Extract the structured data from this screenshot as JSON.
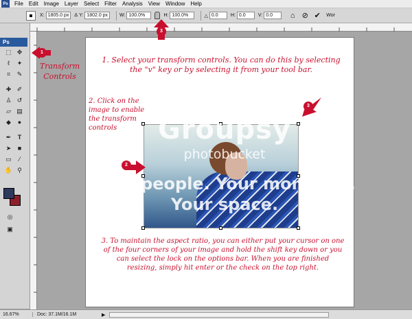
{
  "app": {
    "logo_small": "Ps",
    "logo_panel": "Ps"
  },
  "menu": [
    "File",
    "Edit",
    "Image",
    "Layer",
    "Select",
    "Filter",
    "Analysis",
    "View",
    "Window",
    "Help"
  ],
  "options": {
    "x_label": "X:",
    "x_value": "1805.0 px",
    "y_label": "Y:",
    "y_value": "1802.0 px",
    "w_label": "W:",
    "w_value": "100.0%",
    "h_label": "H:",
    "h_value": "100.0%",
    "rot_value": "0.0",
    "hskew_label": "H:",
    "hskew_value": "0.0",
    "vskew_label": "V:",
    "vskew_value": "0.0",
    "workspace_label": "Wor"
  },
  "status": {
    "zoom": "16.67%",
    "doc": "Doc: 37.1M/16.1M"
  },
  "annotations": {
    "transform_controls": "Transform Controls",
    "step1": "1. Select your transform controls. You can do this by selecting the \"v\" key or by selecting it from your tool bar.",
    "step2": "2. Click on the image to enable the transform controls",
    "step3": "3. To maintain the aspect ratio, you can either put your cursor on one of the four corners of your image and hold the shift key down or you can select the lock on the options bar. When you are finished resizing, simply hit enter or the check on the top right.",
    "badge1": "1",
    "badge2": "2",
    "badge3a": "3",
    "badge3b": "3"
  },
  "watermark": {
    "brand": "Groupsy",
    "sub": "photobucket",
    "line1": "Your people. Your moments.",
    "line2": "Your space."
  },
  "colors": {
    "annotation_red": "#c8102e",
    "foreground_swatch": "#2e3a5c",
    "background_swatch": "#8d1f2b"
  },
  "icons": [
    "move-tool-icon",
    "marquee-tool-icon",
    "lasso-tool-icon",
    "magic-wand-icon",
    "crop-tool-icon",
    "slice-tool-icon",
    "healing-brush-icon",
    "brush-tool-icon",
    "clone-stamp-icon",
    "history-brush-icon",
    "eraser-tool-icon",
    "gradient-tool-icon",
    "blur-tool-icon",
    "dodge-tool-icon",
    "pen-tool-icon",
    "type-tool-icon",
    "path-select-icon",
    "shape-tool-icon",
    "notes-tool-icon",
    "eyedropper-icon",
    "hand-tool-icon",
    "zoom-tool-icon",
    "lock-icon",
    "cancel-icon",
    "commit-check-icon"
  ]
}
